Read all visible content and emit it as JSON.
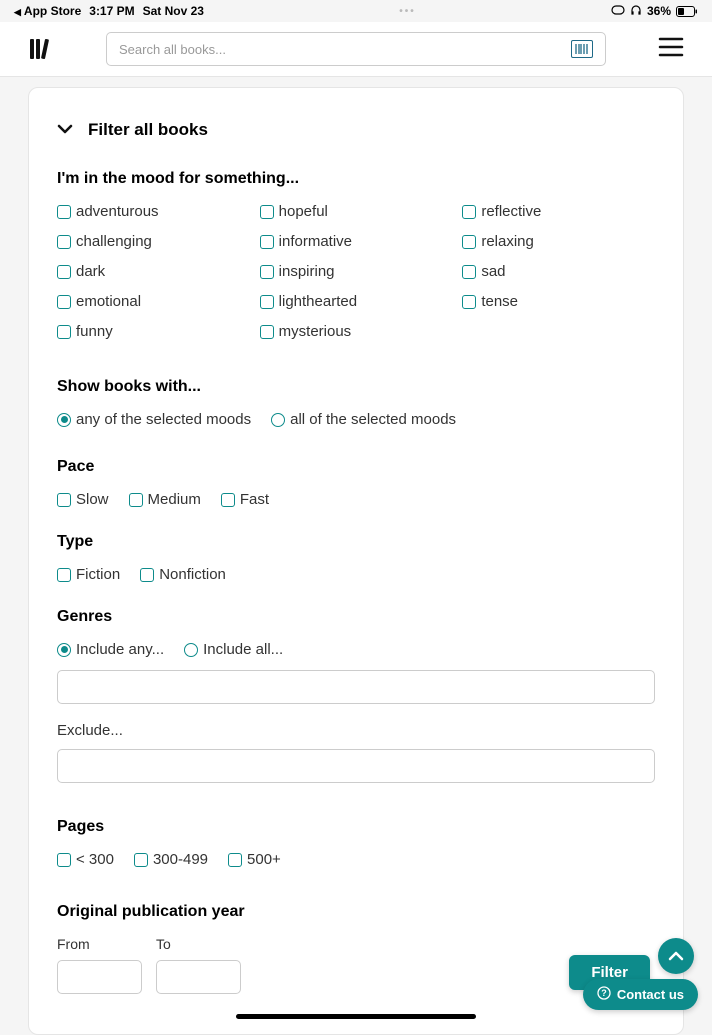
{
  "status_bar": {
    "back_app": "App Store",
    "time": "3:17 PM",
    "date": "Sat Nov 23",
    "battery_pct": "36%"
  },
  "header": {
    "search_placeholder": "Search all books..."
  },
  "filter": {
    "title": "Filter all books",
    "mood_heading": "I'm in the mood for something...",
    "moods": [
      "adventurous",
      "hopeful",
      "reflective",
      "challenging",
      "informative",
      "relaxing",
      "dark",
      "inspiring",
      "sad",
      "emotional",
      "lighthearted",
      "tense",
      "funny",
      "mysterious"
    ],
    "show_heading": "Show books with...",
    "show_options": {
      "any": "any of the selected moods",
      "all": "all of the selected moods"
    },
    "pace_heading": "Pace",
    "pace_options": [
      "Slow",
      "Medium",
      "Fast"
    ],
    "type_heading": "Type",
    "type_options": [
      "Fiction",
      "Nonfiction"
    ],
    "genres_heading": "Genres",
    "genres_include_any": "Include any...",
    "genres_include_all": "Include all...",
    "genres_exclude": "Exclude...",
    "pages_heading": "Pages",
    "pages_options": [
      "< 300",
      "300-499",
      "500+"
    ],
    "year_heading": "Original publication year",
    "year_from": "From",
    "year_to": "To"
  },
  "buttons": {
    "filter": "Filter",
    "contact": "Contact us"
  }
}
